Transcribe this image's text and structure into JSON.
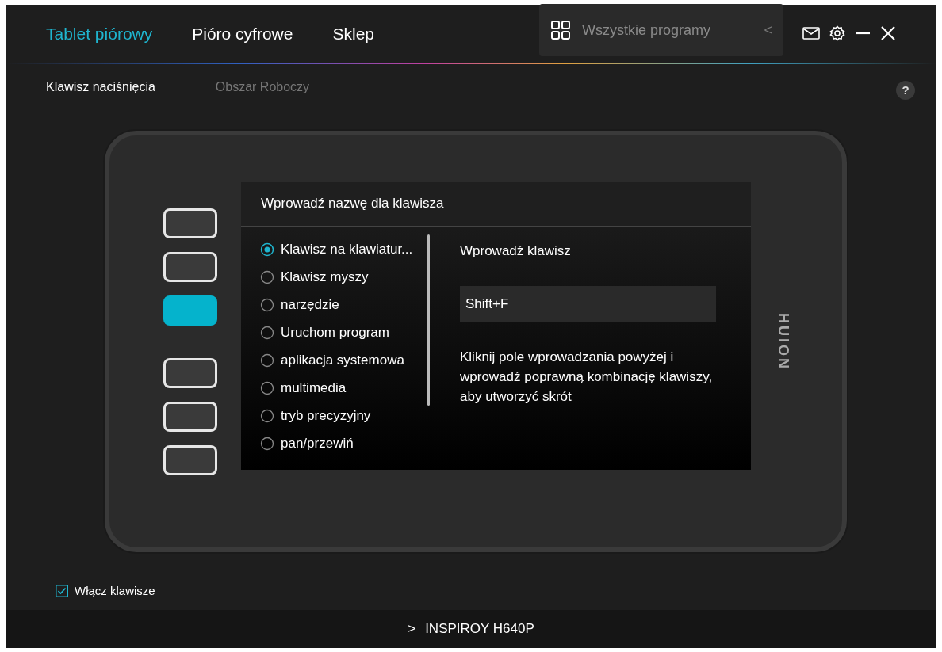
{
  "nav_tabs": [
    {
      "label": "Tablet piórowy",
      "selected": true
    },
    {
      "label": "Pióro cyfrowe",
      "selected": false
    },
    {
      "label": "Sklep",
      "selected": false
    }
  ],
  "app_selector": {
    "label": "Wszystkie programy",
    "arrow": "<"
  },
  "sub_tabs": [
    {
      "label": "Klawisz naciśnięcia",
      "selected": true
    },
    {
      "label": "Obszar Roboczy",
      "selected": false
    }
  ],
  "help": "?",
  "tablet": {
    "logo": "HUION",
    "keys": [
      {
        "selected": false
      },
      {
        "selected": false
      },
      {
        "selected": true
      },
      {
        "selected": false
      },
      {
        "selected": false
      },
      {
        "selected": false
      }
    ]
  },
  "dialog": {
    "title": "Wprowadź nazwę dla klawisza",
    "options": [
      {
        "label": "Klawisz na klawiatur...",
        "selected": true
      },
      {
        "label": "Klawisz myszy",
        "selected": false
      },
      {
        "label": "narzędzie",
        "selected": false
      },
      {
        "label": "Uruchom program",
        "selected": false
      },
      {
        "label": "aplikacja systemowa",
        "selected": false
      },
      {
        "label": "multimedia",
        "selected": false
      },
      {
        "label": "tryb precyzyjny",
        "selected": false
      },
      {
        "label": "pan/przewiń",
        "selected": false
      }
    ],
    "input_label": "Wprowadź klawisz",
    "input_value": "Shift+F",
    "hint": "Kliknij pole wprowadzania powyżej i wprowadź poprawną kombinację klawiszy, aby utworzyć skrót"
  },
  "enable_keys": {
    "label": "Włącz klawisze",
    "checked": true
  },
  "device": {
    "arrow": ">",
    "name": "INSPIROY H640P"
  }
}
